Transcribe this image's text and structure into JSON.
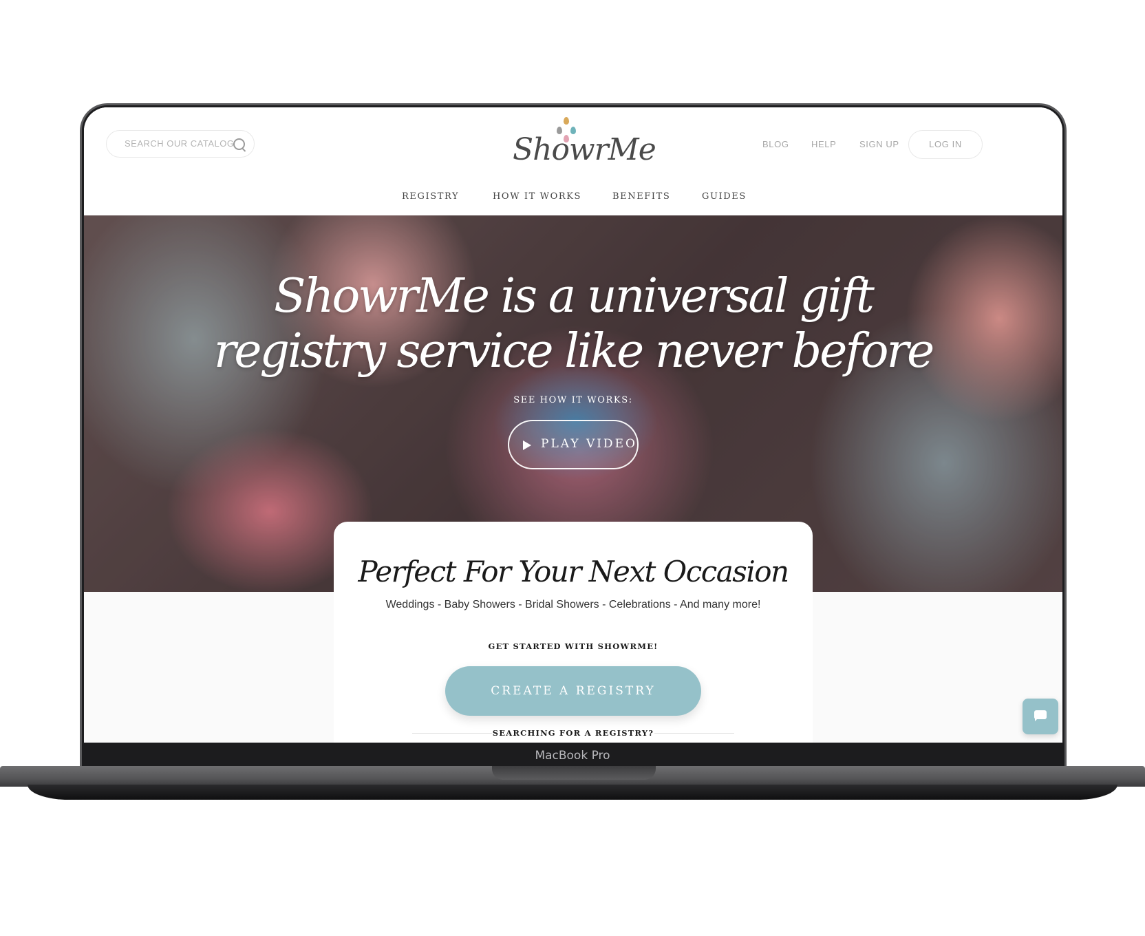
{
  "device": {
    "label": "MacBook Pro"
  },
  "header": {
    "search_placeholder": "SEARCH OUR CATALOG",
    "logo_text": "ShowrMe",
    "logo_drop_colors": [
      "#d9a95a",
      "#9a9a9a",
      "#6fb3ba",
      "#e3a3b3"
    ],
    "links": [
      {
        "label": "BLOG"
      },
      {
        "label": "HELP"
      },
      {
        "label": "SIGN UP"
      }
    ],
    "login_label": "LOG IN"
  },
  "nav": {
    "items": [
      {
        "label": "REGISTRY"
      },
      {
        "label": "HOW IT WORKS"
      },
      {
        "label": "BENEFITS"
      },
      {
        "label": "GUIDES"
      }
    ]
  },
  "hero": {
    "title_line1": "ShowrMe is a universal gift",
    "title_line2": "registry service like never before",
    "subtitle": "SEE HOW IT WORKS:",
    "play_label": "PLAY VIDEO"
  },
  "card": {
    "title": "Perfect For Your Next Occasion",
    "subtitle": "Weddings - Baby Showers - Bridal Showers - Celebrations - And many more!",
    "get_started": "GET STARTED WITH SHOWRME!",
    "create_label": "CREATE A REGISTRY",
    "searching_label": "SEARCHING FOR A REGISTRY?"
  },
  "colors": {
    "accent": "#95c1c9",
    "text": "#1a1a1a",
    "muted": "#a6a6a6"
  }
}
